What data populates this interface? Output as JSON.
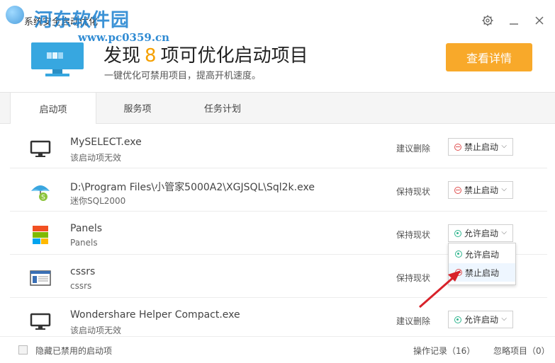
{
  "window": {
    "title": "系统安全启动优化",
    "watermark": "河东软件园",
    "watermark_url": "www.pc0359.cn"
  },
  "hero": {
    "title_prefix": "发现",
    "count": "8",
    "title_suffix": "项可优化启动项目",
    "subtitle": "一键优化可禁用项目，提高开机速度。",
    "detail_button": "查看详情"
  },
  "tabs": [
    {
      "label": "启动项",
      "active": true
    },
    {
      "label": "服务项",
      "active": false
    },
    {
      "label": "任务计划",
      "active": false
    }
  ],
  "items": [
    {
      "name": "MySELECT.exe",
      "desc": "该启动项无效",
      "advice": "建议删除",
      "state": "禁止启动",
      "state_type": "ban",
      "icon": "monitor-icon"
    },
    {
      "name": "D:\\Program Files\\小管家5000A2\\XGJSQL\\Sql2k.exe",
      "desc": "迷你SQL2000",
      "advice": "保持现状",
      "state": "禁止启动",
      "state_type": "ban",
      "icon": "umbrella-icon"
    },
    {
      "name": "Panels",
      "desc": "Panels",
      "advice": "保持现状",
      "state": "允许启动",
      "state_type": "allow",
      "icon": "windows-icon"
    },
    {
      "name": "cssrs",
      "desc": "cssrs",
      "advice": "保持现状",
      "state": "",
      "state_type": "",
      "icon": "window-icon"
    },
    {
      "name": "Wondershare Helper Compact.exe",
      "desc": "该启动项无效",
      "advice": "建议删除",
      "state": "允许启动",
      "state_type": "allow",
      "icon": "monitor-icon"
    }
  ],
  "dropdown": {
    "options": [
      "允许启动",
      "禁止启动"
    ]
  },
  "footer": {
    "hide_disabled_label": "隐藏已禁用的启动项",
    "log_label": "操作记录（16）",
    "ignore_label": "忽略项目（0）"
  }
}
